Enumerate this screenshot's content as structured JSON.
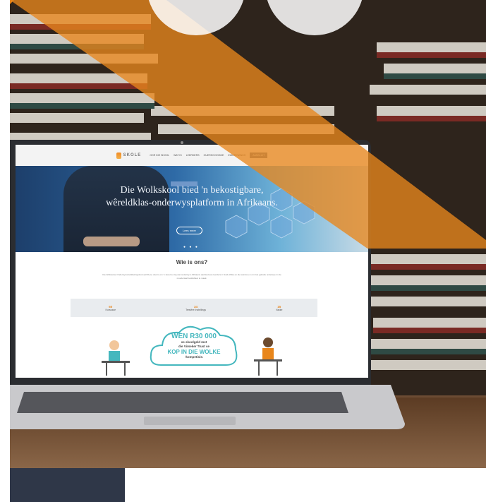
{
  "site": {
    "logo": "SKOLE",
    "nav": [
      "OOR DIE SKOOL",
      "WAT IS",
      "LEERDERS",
      "OUERS/VOOGDE",
      "INSKRYWINGS",
      "AANSLUIT"
    ]
  },
  "hero": {
    "title_line1": "Die Wolkskool bied 'n bekostigbare,",
    "title_line2": "wêreldklas-onderwysplatform in Afrikaans.",
    "button": "Lees meer",
    "dots": "● ● ●"
  },
  "about": {
    "title": "Wie is ons?",
    "text": "Die Afrikaanse Onderwysontwikkelingstrust (AOO) se doel is om 'n skool te stig wat onderrig in Afrikaans aanbied aan leerders in Suid-Afrika en die wêreld, en om hoë gehalte onderwys in die moedertaal beskikbaar te maak.",
    "stats": [
      {
        "num": "50",
        "label": "Kursusse"
      },
      {
        "num": "34",
        "label": "Tersiêre Instellings"
      },
      {
        "num": "15",
        "label": "Vakke"
      }
    ]
  },
  "promo": {
    "line1": "WEN R30 000",
    "line2": "se skoolgeld met",
    "line3": "die Virseker Trust se",
    "line4": "KOP IN DIE WOLKE",
    "line5": "-kompetisie."
  },
  "colors": {
    "orange": "#e8861c",
    "navy": "#2f3748",
    "teal": "#44b7be"
  }
}
